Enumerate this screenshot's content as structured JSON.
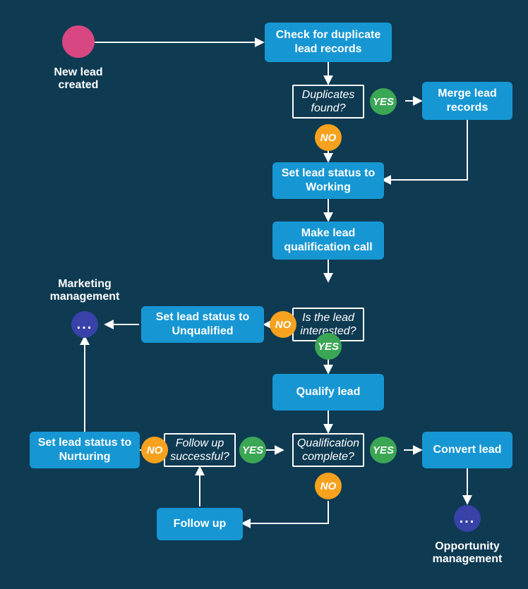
{
  "start_label": "New lead created",
  "processes": {
    "check_dup": "Check for duplicate lead records",
    "merge": "Merge lead records",
    "set_working": "Set lead status to Working",
    "make_call": "Make lead qualification call",
    "set_unqualified": "Set lead status to Unqualified",
    "qualify": "Qualify lead",
    "set_nurturing": "Set lead status to Nurturing",
    "followup": "Follow up",
    "convert": "Convert lead"
  },
  "decisions": {
    "dup_found": "Duplicates found?",
    "interested": "Is the lead interested?",
    "followup_ok": "Follow up successful?",
    "qual_complete": "Qualification complete?"
  },
  "branches": {
    "yes": "YES",
    "no": "NO"
  },
  "subprocess_labels": {
    "marketing": "Marketing management",
    "opportunity": "Opportunity management"
  },
  "ellipsis": "..."
}
